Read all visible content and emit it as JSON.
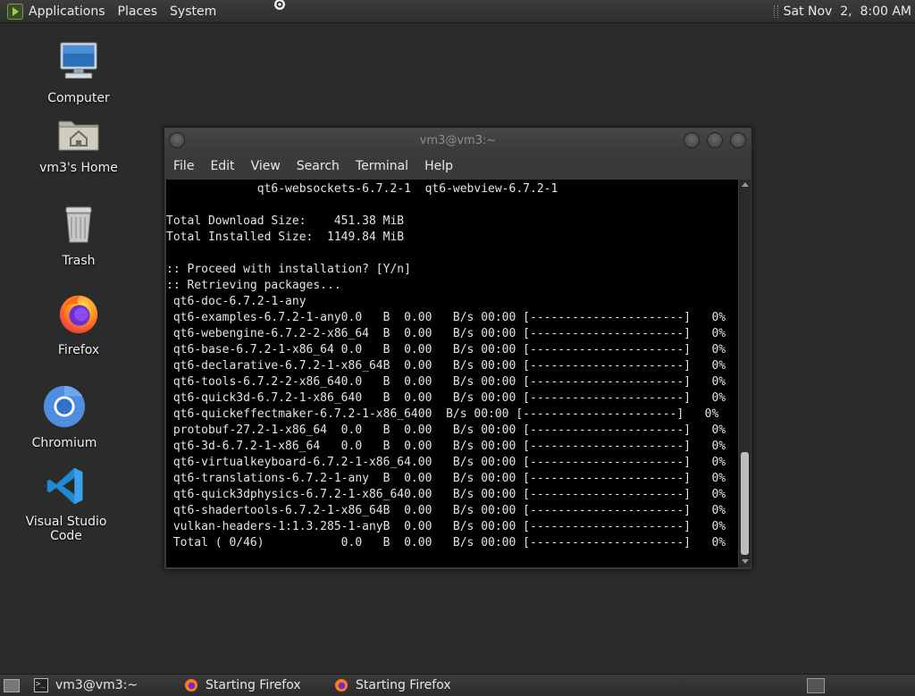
{
  "top_panel": {
    "menus": [
      "Applications",
      "Places",
      "System"
    ],
    "clock": "Sat Nov  2,  8:00 AM"
  },
  "desktop_icons": [
    {
      "label": "Computer",
      "icon": "computer-icon"
    },
    {
      "label": "vm3's Home",
      "icon": "home-folder-icon"
    },
    {
      "label": "Trash",
      "icon": "trash-icon"
    },
    {
      "label": "Firefox",
      "icon": "firefox-icon"
    },
    {
      "label": "Chromium",
      "icon": "chromium-icon"
    },
    {
      "label": "Visual Studio Code",
      "icon": "vscode-icon"
    }
  ],
  "terminal": {
    "title": "vm3@vm3:~",
    "menus": [
      "File",
      "Edit",
      "View",
      "Search",
      "Terminal",
      "Help"
    ],
    "lines": [
      "             qt6-websockets-6.7.2-1  qt6-webview-6.7.2-1",
      "",
      "Total Download Size:    451.38 MiB",
      "Total Installed Size:  1149.84 MiB",
      "",
      ":: Proceed with installation? [Y/n]",
      ":: Retrieving packages...",
      " qt6-doc-6.7.2-1-any",
      " qt6-examples-6.7.2-1-any0.0   B  0.00   B/s 00:00 [----------------------]   0%",
      " qt6-webengine-6.7.2-2-x86_64  B  0.00   B/s 00:00 [----------------------]   0%",
      " qt6-base-6.7.2-1-x86_64 0.0   B  0.00   B/s 00:00 [----------------------]   0%",
      " qt6-declarative-6.7.2-1-x86_64B  0.00   B/s 00:00 [----------------------]   0%",
      " qt6-tools-6.7.2-2-x86_640.0   B  0.00   B/s 00:00 [----------------------]   0%",
      " qt6-quick3d-6.7.2-1-x86_640   B  0.00   B/s 00:00 [----------------------]   0%",
      " qt6-quickeffectmaker-6.7.2-1-x86_6400  B/s 00:00 [----------------------]   0%",
      " protobuf-27.2-1-x86_64  0.0   B  0.00   B/s 00:00 [----------------------]   0%",
      " qt6-3d-6.7.2-1-x86_64   0.0   B  0.00   B/s 00:00 [----------------------]   0%",
      " qt6-virtualkeyboard-6.7.2-1-x86_64.00   B/s 00:00 [----------------------]   0%",
      " qt6-translations-6.7.2-1-any  B  0.00   B/s 00:00 [----------------------]   0%",
      " qt6-quick3dphysics-6.7.2-1-x86_640.00   B/s 00:00 [----------------------]   0%",
      " qt6-shadertools-6.7.2-1-x86_64B  0.00   B/s 00:00 [----------------------]   0%",
      " vulkan-headers-1:1.3.285-1-anyB  0.00   B/s 00:00 [----------------------]   0%",
      " Total ( 0/46)           0.0   B  0.00   B/s 00:00 [----------------------]   0%"
    ]
  },
  "taskbar": {
    "tasks": [
      {
        "label": "vm3@vm3:~",
        "icon": "terminal-icon"
      },
      {
        "label": "Starting Firefox",
        "icon": "firefox-icon"
      },
      {
        "label": "Starting Firefox",
        "icon": "firefox-icon"
      }
    ]
  },
  "colors": {
    "desktop_bg": "#2b2b2b",
    "terminal_bg": "#000000",
    "panel_bg": "#333333"
  }
}
